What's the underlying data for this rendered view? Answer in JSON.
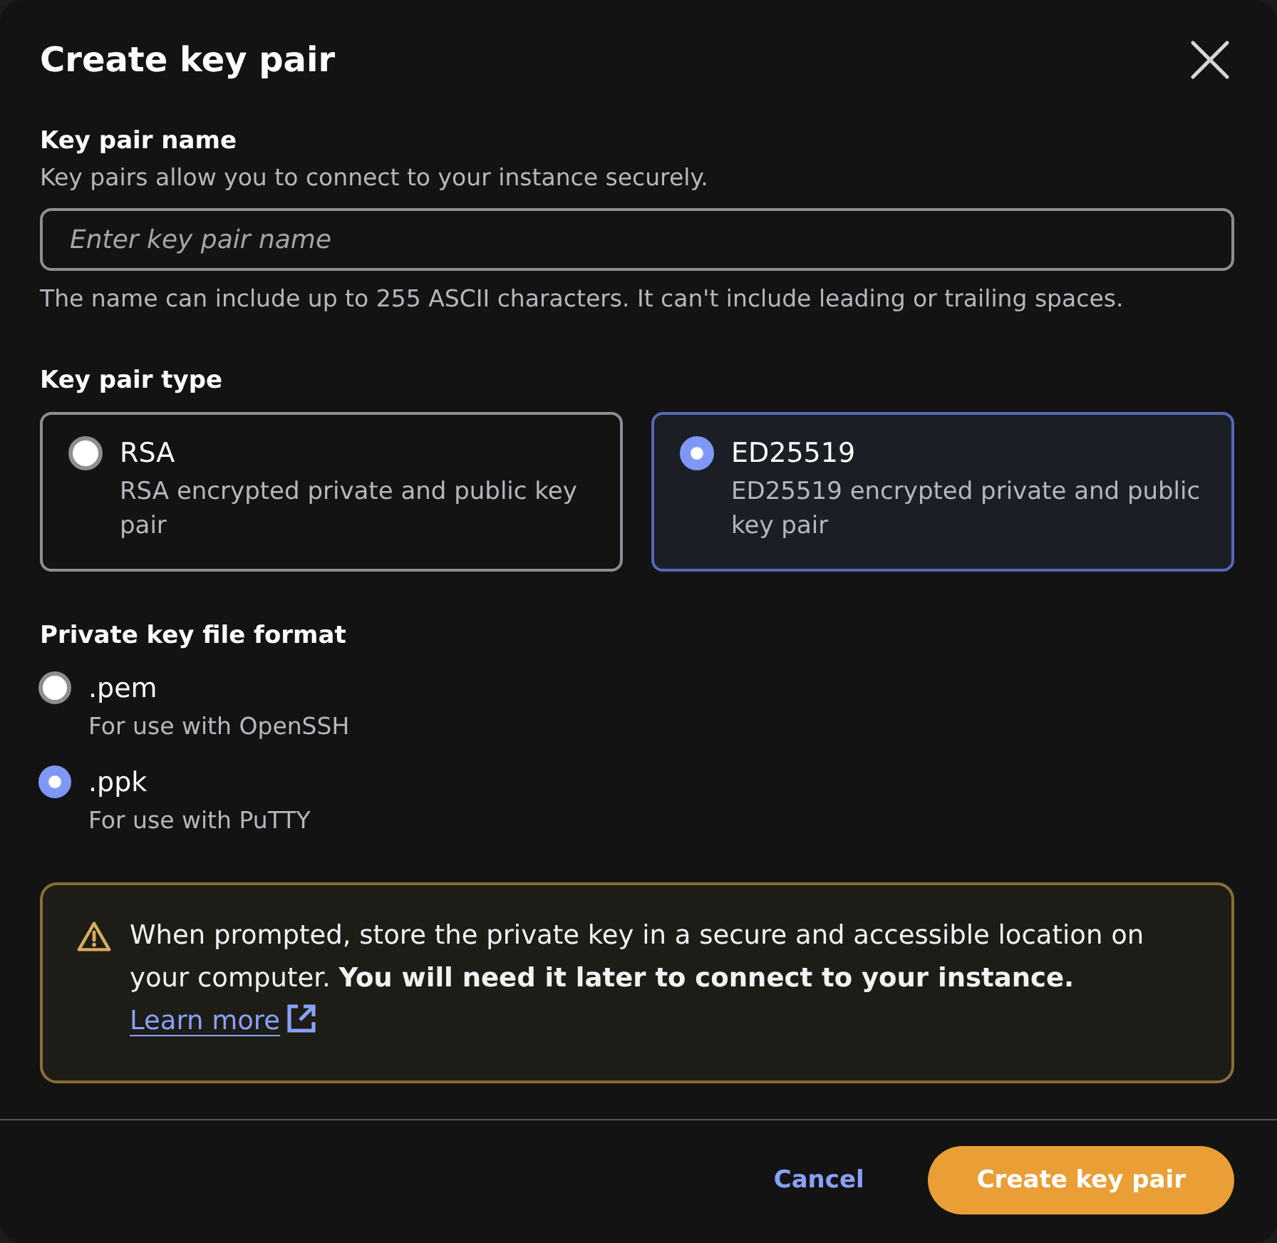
{
  "dialog": {
    "title": "Create key pair"
  },
  "key_pair_name": {
    "label": "Key pair name",
    "description": "Key pairs allow you to connect to your instance securely.",
    "placeholder": "Enter key pair name",
    "constraint": "The name can include up to 255 ASCII characters. It can't include leading or trailing spaces."
  },
  "key_pair_type": {
    "label": "Key pair type",
    "options": [
      {
        "label": "RSA",
        "description": "RSA encrypted private and public key pair",
        "selected": false
      },
      {
        "label": "ED25519",
        "description": "ED25519 encrypted private and public key pair",
        "selected": true
      }
    ]
  },
  "private_key_file_format": {
    "label": "Private key file format",
    "options": [
      {
        "label": ".pem",
        "description": "For use with OpenSSH",
        "selected": false
      },
      {
        "label": ".ppk",
        "description": "For use with PuTTY",
        "selected": true
      }
    ]
  },
  "alert": {
    "text": "When prompted, store the private key in a secure and accessible location on your computer. **You will need it later to connect to your instance.**",
    "link": "Learn more"
  },
  "footer": {
    "buttons": [
      {
        "label": "Cancel",
        "kind": "link"
      },
      {
        "label": "Create key pair",
        "kind": "primary"
      }
    ]
  }
}
